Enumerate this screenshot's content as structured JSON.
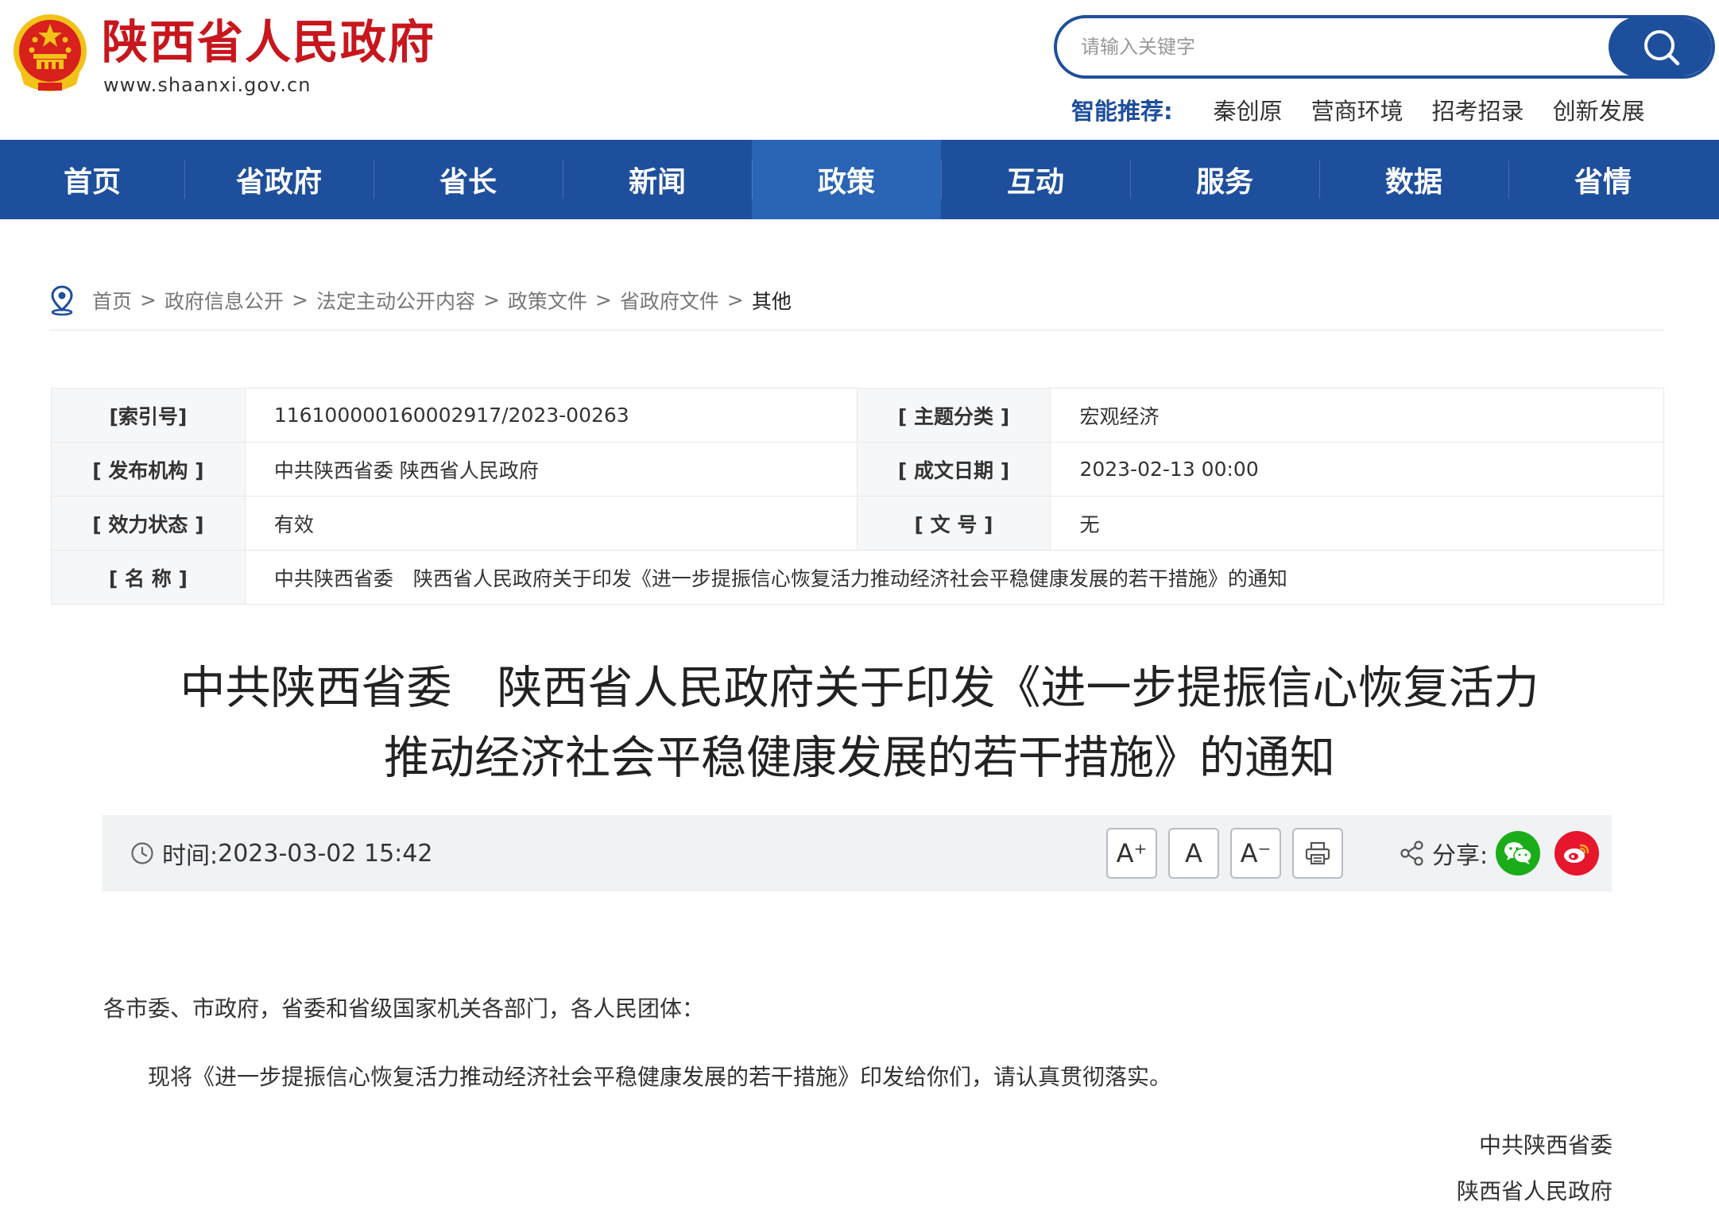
{
  "header": {
    "site_name": "陕西省人民政府",
    "site_url": "www.shaanxi.gov.cn",
    "search_placeholder": "请输入关键字",
    "recommend_label": "智能推荐:",
    "recommend_links": [
      "秦创原",
      "营商环境",
      "招考招录",
      "创新发展"
    ]
  },
  "nav": {
    "items": [
      "首页",
      "省政府",
      "省长",
      "新闻",
      "政策",
      "互动",
      "服务",
      "数据",
      "省情"
    ],
    "active": "政策"
  },
  "breadcrumb": {
    "items": [
      "首页",
      "政府信息公开",
      "法定主动公开内容",
      "政策文件",
      "省政府文件"
    ],
    "current": "其他",
    "separator": ">"
  },
  "info": {
    "index_label": "[索引号]",
    "index_value": "11610000016000291​7/2023-00263",
    "topic_label": "[ 主题分类 ]",
    "topic_value": "宏观经济",
    "issuer_label": "[ 发布机构 ]",
    "issuer_value": "中共陕西省委 陕西省人民政府",
    "date_label": "[ 成文日期 ]",
    "date_value": "2023-02-13 00:00",
    "status_label": "[ 效力状态 ]",
    "status_value": "有效",
    "docno_label": "[ 文 号 ]",
    "docno_value": "无",
    "name_label": "[ 名 称 ]",
    "name_value": "中共陕西省委　陕西省人民政府关于印发《进一步提振信心恢复活力推动经济社会平稳健康发展的若干措施》的通知"
  },
  "article": {
    "title_line1": "中共陕西省委　陕西省人民政府关于印发《进一步提振信心恢复活力",
    "title_line2": "推动经济社会平稳健康发展的若干措施》的通知",
    "time_label": "时间:",
    "time_value": "2023-03-02 15:42",
    "share_label": "分享:",
    "font_buttons": [
      "A⁺",
      "A",
      "A⁻"
    ],
    "salutation": "各市委、市政府，省委和省级国家机关各部门，各人民团体：",
    "paragraph1": "现将《进一步提振信心恢复活力推动经济社会平稳健康发展的若干措施》印发给你们，请认真贯彻落实。",
    "signature1": "中共陕西省委",
    "signature2": "陕西省人民政府"
  },
  "colors": {
    "brand_red": "#c8161d",
    "nav_blue": "#1e4f9c",
    "nav_active": "#2a64b4",
    "wechat_green": "#1aad19",
    "weibo_red": "#e6162d"
  }
}
